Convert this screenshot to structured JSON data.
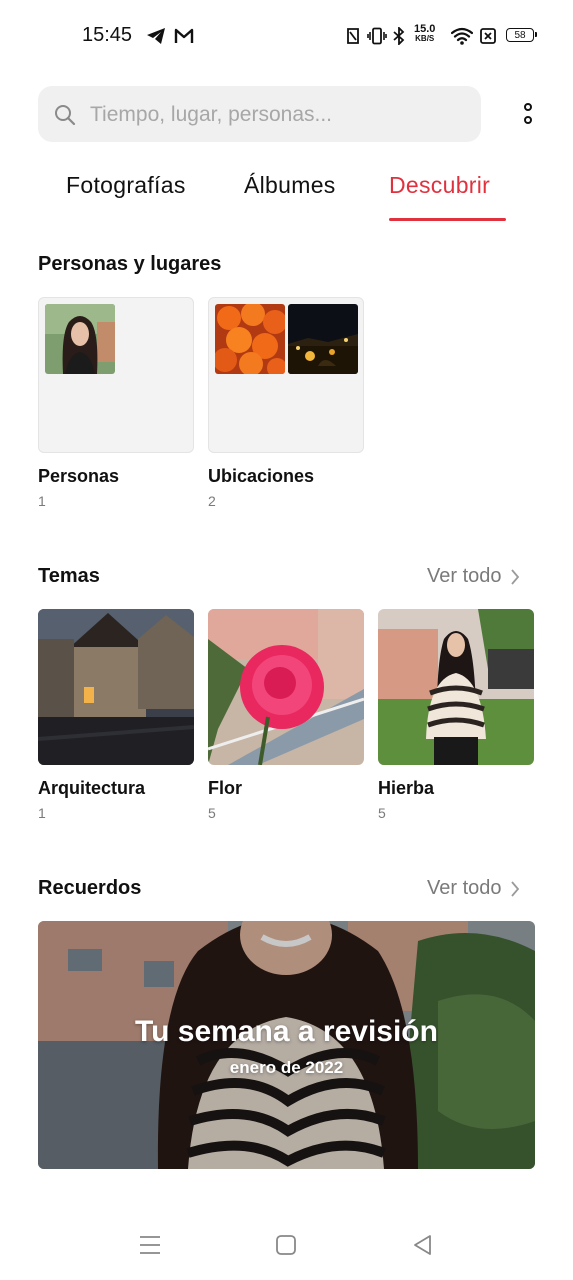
{
  "status_bar": {
    "time": "15:45",
    "net_speed_value": "15.0",
    "net_speed_unit": "KB/S",
    "battery": "58",
    "icons": [
      "telegram-icon",
      "gmail-icon",
      "nfc-icon",
      "vibrate-icon",
      "bluetooth-icon",
      "wifi-icon",
      "sim-off-icon",
      "battery-icon"
    ]
  },
  "search": {
    "placeholder": "Tiempo, lugar, personas..."
  },
  "tabs": [
    {
      "label": "Fotografías"
    },
    {
      "label": "Álbumes"
    },
    {
      "label": "Descubrir",
      "active": true
    }
  ],
  "people_places": {
    "title": "Personas y lugares",
    "items": [
      {
        "label": "Personas",
        "count": "1"
      },
      {
        "label": "Ubicaciones",
        "count": "2"
      }
    ]
  },
  "topics": {
    "title": "Temas",
    "see_all": "Ver todo",
    "items": [
      {
        "label": "Arquitectura",
        "count": "1"
      },
      {
        "label": "Flor",
        "count": "5"
      },
      {
        "label": "Hierba",
        "count": "5"
      }
    ]
  },
  "memories": {
    "title": "Recuerdos",
    "see_all": "Ver todo",
    "card_title": "Tu semana a revisión",
    "card_subtitle": "enero de 2022"
  },
  "colors": {
    "accent": "#e0323e",
    "search_bg": "#f0f0f0",
    "muted_text": "#7a7a7a"
  }
}
